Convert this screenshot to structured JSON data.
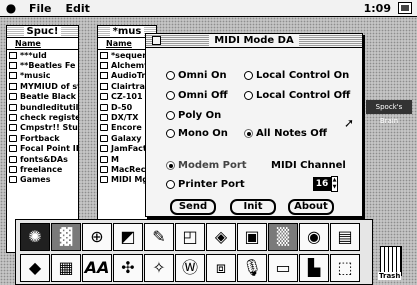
{
  "menubar": {
    "apple": "",
    "items": [
      "File",
      "Edit"
    ],
    "clock": "1:09"
  },
  "windows": [
    {
      "title": "Spuc!",
      "column_header": "Name",
      "rows": [
        {
          "icon": "doc",
          "name": "***uld"
        },
        {
          "icon": "doc",
          "name": "**Beatles Fe"
        },
        {
          "icon": "doc",
          "name": "*music"
        },
        {
          "icon": "doc",
          "name": "MYMIUD of st"
        },
        {
          "icon": "folder",
          "name": "Beatle Black"
        },
        {
          "icon": "folder",
          "name": "bundleditutil"
        },
        {
          "icon": "folder",
          "name": "check register"
        },
        {
          "icon": "folder",
          "name": "Cmpstr!! Stuf"
        },
        {
          "icon": "folder",
          "name": "Fortback"
        },
        {
          "icon": "folder",
          "name": "Focal Point II"
        },
        {
          "icon": "folder",
          "name": "fonts&DAs"
        },
        {
          "icon": "folder",
          "name": "freelance"
        },
        {
          "icon": "folder",
          "name": "Games"
        }
      ]
    },
    {
      "title": "*mus",
      "column_header": "Name",
      "rows": [
        {
          "icon": "doc",
          "name": "*sequencer"
        },
        {
          "icon": "doc",
          "name": "Alchemy"
        },
        {
          "icon": "doc",
          "name": "AudioTrax"
        },
        {
          "icon": "doc",
          "name": "Clairtrakx"
        },
        {
          "icon": "folder",
          "name": "CZ-101"
        },
        {
          "icon": "folder",
          "name": "D-50"
        },
        {
          "icon": "folder",
          "name": "DX/TX"
        },
        {
          "icon": "folder",
          "name": "Encore"
        },
        {
          "icon": "folder",
          "name": "Galaxy"
        },
        {
          "icon": "folder",
          "name": "JamFactory"
        },
        {
          "icon": "folder",
          "name": "M"
        },
        {
          "icon": "folder",
          "name": "MacRecorder"
        },
        {
          "icon": "folder",
          "name": "MIDI Mgr"
        }
      ]
    }
  ],
  "dark_strip_label": "Spock's Brain",
  "dialog": {
    "title": "MIDI Mode DA",
    "options": {
      "omni_on": "Omni On",
      "omni_off": "Omni Off",
      "local_on": "Local Control On",
      "local_off": "Local Control Off",
      "poly_on": "Poly On",
      "mono_on": "Mono On",
      "all_notes_off": "All Notes Off",
      "modem_port": "Modem Port",
      "printer_port": "Printer Port"
    },
    "midi_channel_label": "MIDI Channel",
    "midi_channel_value": "16",
    "buttons": {
      "send": "Send",
      "init": "Init",
      "about": "About"
    }
  },
  "trash_label": "Trash"
}
